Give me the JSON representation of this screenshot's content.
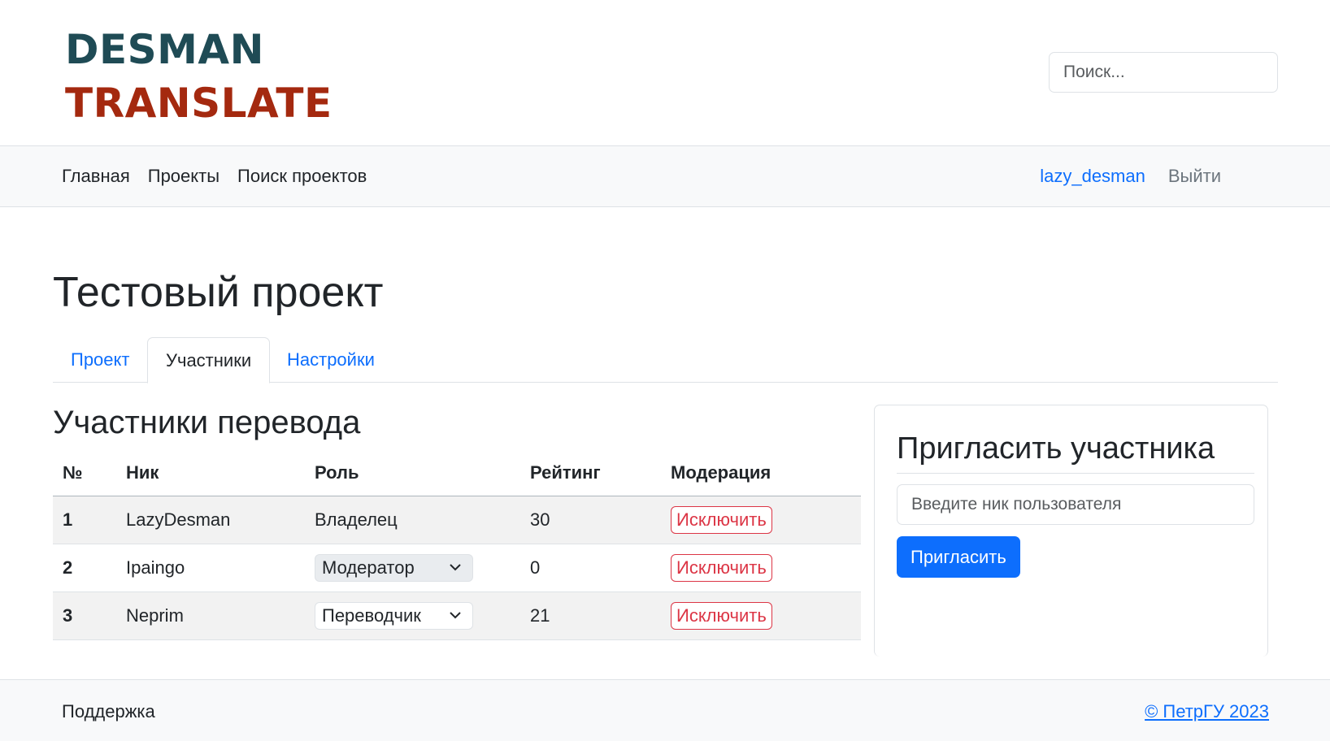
{
  "header": {
    "logo_line1": "DESMAN",
    "logo_line2": "TRANSLATE",
    "search_placeholder": "Поиск..."
  },
  "nav": {
    "links": [
      "Главная",
      "Проекты",
      "Поиск проектов"
    ],
    "username": "lazy_desman",
    "logout": "Выйти"
  },
  "page": {
    "title": "Тестовый проект",
    "tabs": [
      "Проект",
      "Участники",
      "Настройки"
    ],
    "active_tab": "Участники"
  },
  "members": {
    "section_title": "Участники перевода",
    "columns": [
      "№",
      "Ник",
      "Роль",
      "Рейтинг",
      "Модерация"
    ],
    "rows": [
      {
        "num": "1",
        "nick": "LazyDesman",
        "role": "Владелец",
        "rating": "30",
        "action": "Исключить"
      },
      {
        "num": "2",
        "nick": "Ipaingo",
        "role": "Модератор",
        "rating": "0",
        "action": "Исключить"
      },
      {
        "num": "3",
        "nick": "Neprim",
        "role": "Переводчик",
        "rating": "21",
        "action": "Исключить"
      }
    ]
  },
  "invite": {
    "title": "Пригласить участника",
    "input_placeholder": "Введите ник пользователя",
    "button": "Пригласить"
  },
  "footer": {
    "support": "Поддержка",
    "copyright": "© ПетрГУ 2023"
  },
  "colors": {
    "logo_dark": "#1f4b55",
    "logo_red": "#a4290f",
    "link_blue": "#0d6efd",
    "danger": "#dc3545"
  }
}
